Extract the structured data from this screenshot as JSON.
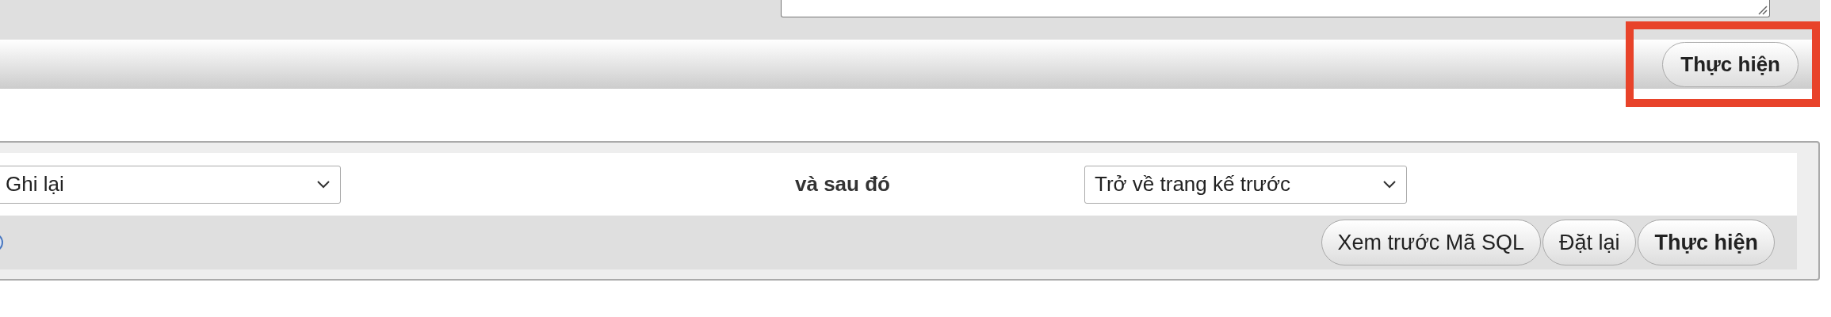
{
  "toolbar": {
    "buttons": [
      {
        "label": "Thực hiện",
        "primary": true
      }
    ]
  },
  "form": {
    "action_select": {
      "value": "Ghi lại"
    },
    "connector": "và sau đó",
    "after_select": {
      "value": "Trở về trang kế trước"
    },
    "buttons": [
      {
        "label": "Xem trước Mã SQL",
        "primary": false
      },
      {
        "label": "Đặt lại",
        "primary": false
      },
      {
        "label": "Thực hiện",
        "primary": true
      }
    ]
  }
}
